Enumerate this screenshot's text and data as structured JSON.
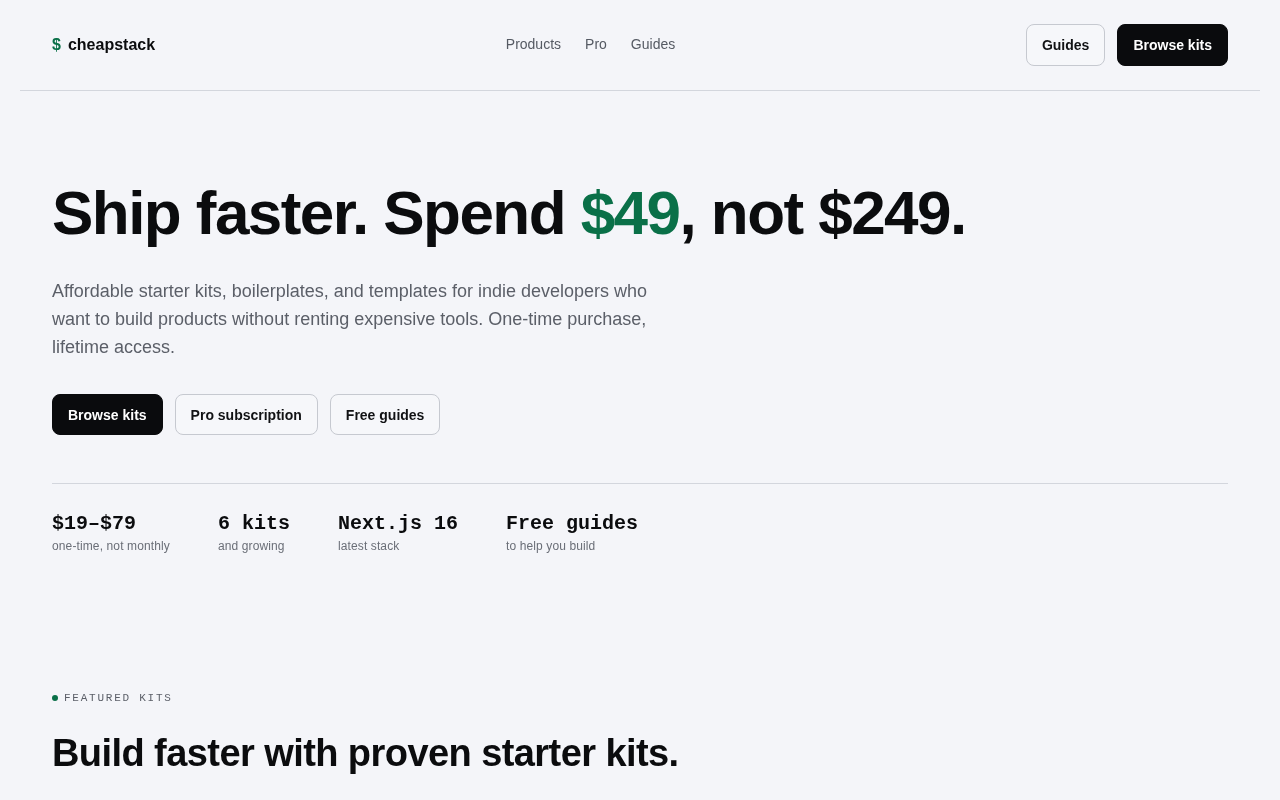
{
  "header": {
    "logo": {
      "symbol": "$",
      "name": "cheapstack"
    },
    "nav": [
      "Products",
      "Pro",
      "Guides"
    ],
    "buttons": [
      {
        "label": "Guides",
        "kind": "outline"
      },
      {
        "label": "Browse kits",
        "kind": "primary"
      }
    ]
  },
  "hero": {
    "headline": [
      {
        "text": "Ship faster. Spend ",
        "accent": false
      },
      {
        "text": "$49",
        "accent": true
      },
      {
        "text": ", not $249.",
        "accent": false
      }
    ],
    "description": "Affordable starter kits, boilerplates, and templates for indie developers who want to build products without renting expensive tools. One-time purchase, lifetime access.",
    "buttons": [
      {
        "label": "Browse kits",
        "kind": "primary"
      },
      {
        "label": "Pro subscription",
        "kind": "outline"
      },
      {
        "label": "Free guides",
        "kind": "outline"
      }
    ],
    "stats": [
      {
        "value": "$19–$79",
        "label": "one-time, not monthly"
      },
      {
        "value": "6 kits",
        "label": "and growing"
      },
      {
        "value": "Next.js 16",
        "label": "latest stack"
      },
      {
        "value": "Free guides",
        "label": "to help you build"
      }
    ]
  },
  "featured": {
    "eyebrow": "FEATURED KITS",
    "title": "Build faster with proven starter kits."
  }
}
